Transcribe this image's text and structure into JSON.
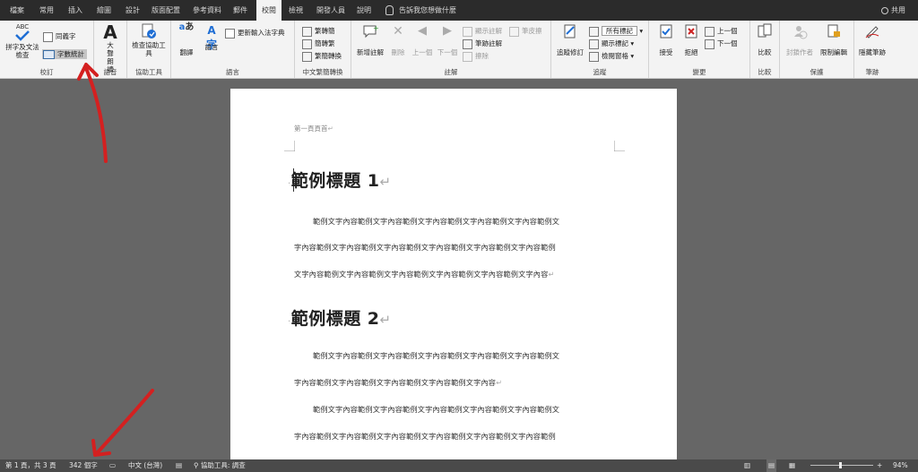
{
  "tabs": [
    "檔案",
    "常用",
    "插入",
    "繪圖",
    "設計",
    "版面配置",
    "參考資料",
    "郵件",
    "校閱",
    "檢視",
    "開發人員",
    "說明"
  ],
  "active_tab": "校閱",
  "tell_me": "告訴我您想做什麼",
  "share_label": "共用",
  "ribbon": {
    "proofing": {
      "spelling_label": "拼字及文法檢查",
      "spelling_abc": "ABC",
      "thesaurus_label": "同義字",
      "wordcount_label": "字數統計",
      "group_label": "校訂"
    },
    "speech": {
      "read_aloud_label": "大聲朗讀",
      "group_label": "語音"
    },
    "accessibility": {
      "check_label": "檢查協助工具",
      "group_label": "協助工具"
    },
    "language": {
      "translate_label": "翻譯",
      "language_label": "語言",
      "ime_label": "更新輸入法字典",
      "group_label": "語言"
    },
    "chinese_conversion": {
      "to_trad": "繁轉簡",
      "to_simp": "簡轉繁",
      "convert": "繁簡轉換",
      "group_label": "中文繁簡轉換"
    },
    "comments": {
      "new": "新增註解",
      "delete": "刪除",
      "prev": "上一個",
      "next": "下一個",
      "show": "顯示註解",
      "ink": "筆跡註解",
      "erase": "擦除",
      "ink_start": "筆皮擦",
      "group_label": "註解"
    },
    "tracking": {
      "track_changes": "追蹤修訂",
      "all_markup": "所有標記",
      "show_markup": "顯示標記",
      "review_pane": "檢閱窗格",
      "group_label": "追蹤"
    },
    "changes": {
      "accept": "接受",
      "reject": "拒絕",
      "prev": "上一個",
      "next": "下一個",
      "group_label": "變更"
    },
    "compare": {
      "compare_label": "比較",
      "group_label": "比較"
    },
    "protect": {
      "block_authors": "封鎖作者",
      "restrict": "限制編輯",
      "group_label": "保護"
    },
    "ink": {
      "hide_ink": "隱藏筆跡",
      "group_label": "筆跡"
    }
  },
  "document": {
    "header_text": "第一頁頁首",
    "heading1": "範例標題 1",
    "heading2": "範例標題 2",
    "para1_line1": "範例文字內容範例文字內容範例文字內容範例文字內容範例文字內容範例文",
    "para1_line2": "字內容範例文字內容範例文字內容範例文字內容範例文字內容範例文字內容範例",
    "para1_line3": "文字內容範例文字內容範例文字內容範例文字內容範例文字內容範例文字內容",
    "para2_line1": "範例文字內容範例文字內容範例文字內容範例文字內容範例文字內容範例文",
    "para2_line2": "字內容範例文字內容範例文字內容範例文字內容範例文字內容",
    "para3_line1": "範例文字內容範例文字內容範例文字內容範例文字內容範例文字內容範例文",
    "para3_line2": "字內容範例文字內容範例文字內容範例文字內容範例文字內容範例文字內容範例"
  },
  "status": {
    "page": "第 1 頁，共 3 頁",
    "word_count": "342 個字",
    "language": "中文 (台灣)",
    "accessibility": "協助工具: 調查",
    "zoom": "94%",
    "zoom_fraction": 0.94
  },
  "colors": {
    "tabbar": "#2b2b2b",
    "ribbon": "#f3f3f3",
    "canvas": "#666666",
    "statusbar": "#4a4a4a",
    "annotation_red": "#d42020"
  }
}
